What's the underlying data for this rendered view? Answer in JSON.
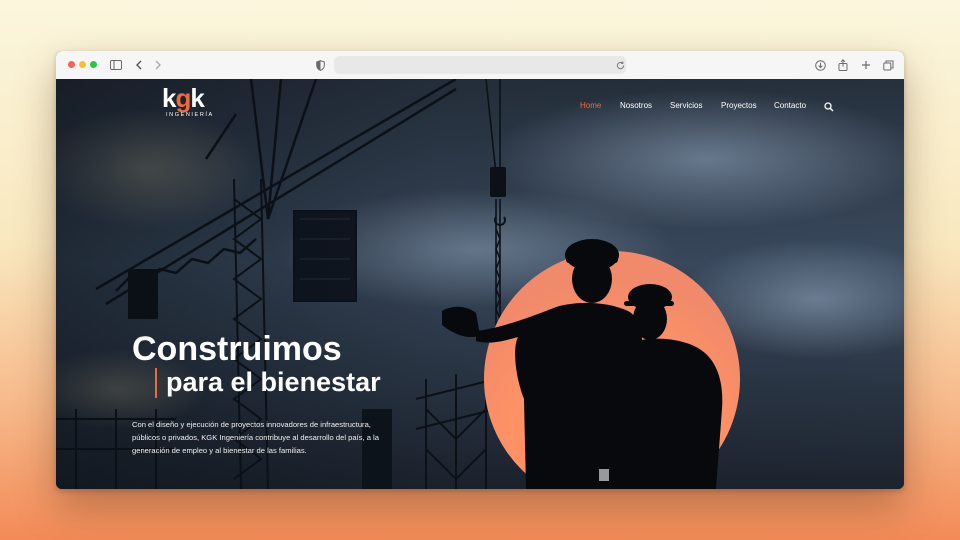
{
  "browser": {
    "address_text": ""
  },
  "site": {
    "logo_letters": {
      "k1": "k",
      "g": "g",
      "k2": "k"
    },
    "logo_subtitle": "INGENIERÍA",
    "nav": [
      {
        "label": "Home",
        "active": true
      },
      {
        "label": "Nosotros",
        "active": false
      },
      {
        "label": "Servicios",
        "active": false
      },
      {
        "label": "Proyectos",
        "active": false
      },
      {
        "label": "Contacto",
        "active": false
      }
    ],
    "hero": {
      "headline_line1": "Construimos",
      "headline_line2": "para el bienestar",
      "description": "Con el diseño y ejecución de proyectos innovadores de infraestructura, públicos o privados, KGK Ingeniería contribuye al desarrollo del país, a la generación de empleo y al bienestar de las familias."
    }
  },
  "colors": {
    "accent": "#ef6a3a",
    "sky_dark": "#1f2a38",
    "text_light": "#ffffff"
  },
  "icons": [
    "sidebar-icon",
    "back-icon",
    "forward-icon",
    "shield-icon",
    "reload-icon",
    "download-icon",
    "share-icon",
    "new-tab-icon",
    "tabs-overview-icon",
    "search-icon"
  ]
}
